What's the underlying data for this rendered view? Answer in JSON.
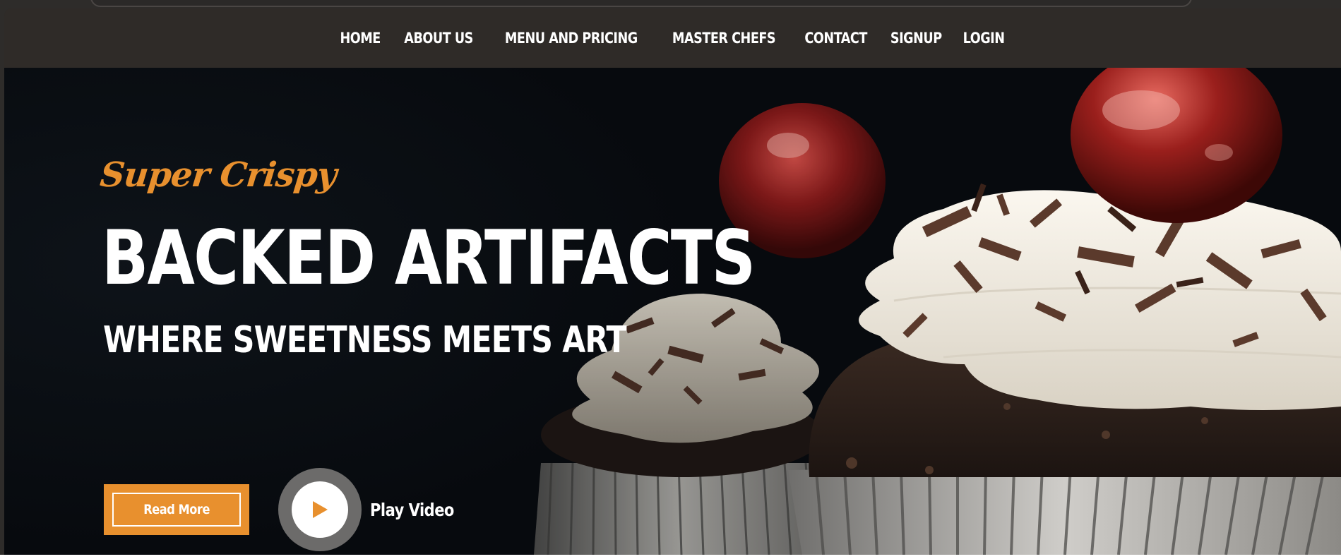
{
  "nav": {
    "items": [
      {
        "label": "HOME"
      },
      {
        "label": "ABOUT US"
      },
      {
        "label": "MENU AND PRICING"
      },
      {
        "label": "MASTER CHEFS"
      },
      {
        "label": "CONTACT"
      },
      {
        "label": "SIGNUP"
      },
      {
        "label": "LOGIN"
      }
    ]
  },
  "hero": {
    "tagline": "Super Crispy",
    "title": "BACKED ARTIFACTS",
    "subtitle": "WHERE SWEETNESS MEETS ART",
    "read_more_label": "Read More",
    "play_label": "Play Video",
    "image_subject": "chocolate cupcakes with whipped cream and cherries"
  },
  "colors": {
    "accent": "#e8902e",
    "nav_background": "#2f2b28",
    "hero_background": "#070a0e",
    "text": "#ffffff"
  },
  "icons": {
    "play": "play-icon"
  }
}
